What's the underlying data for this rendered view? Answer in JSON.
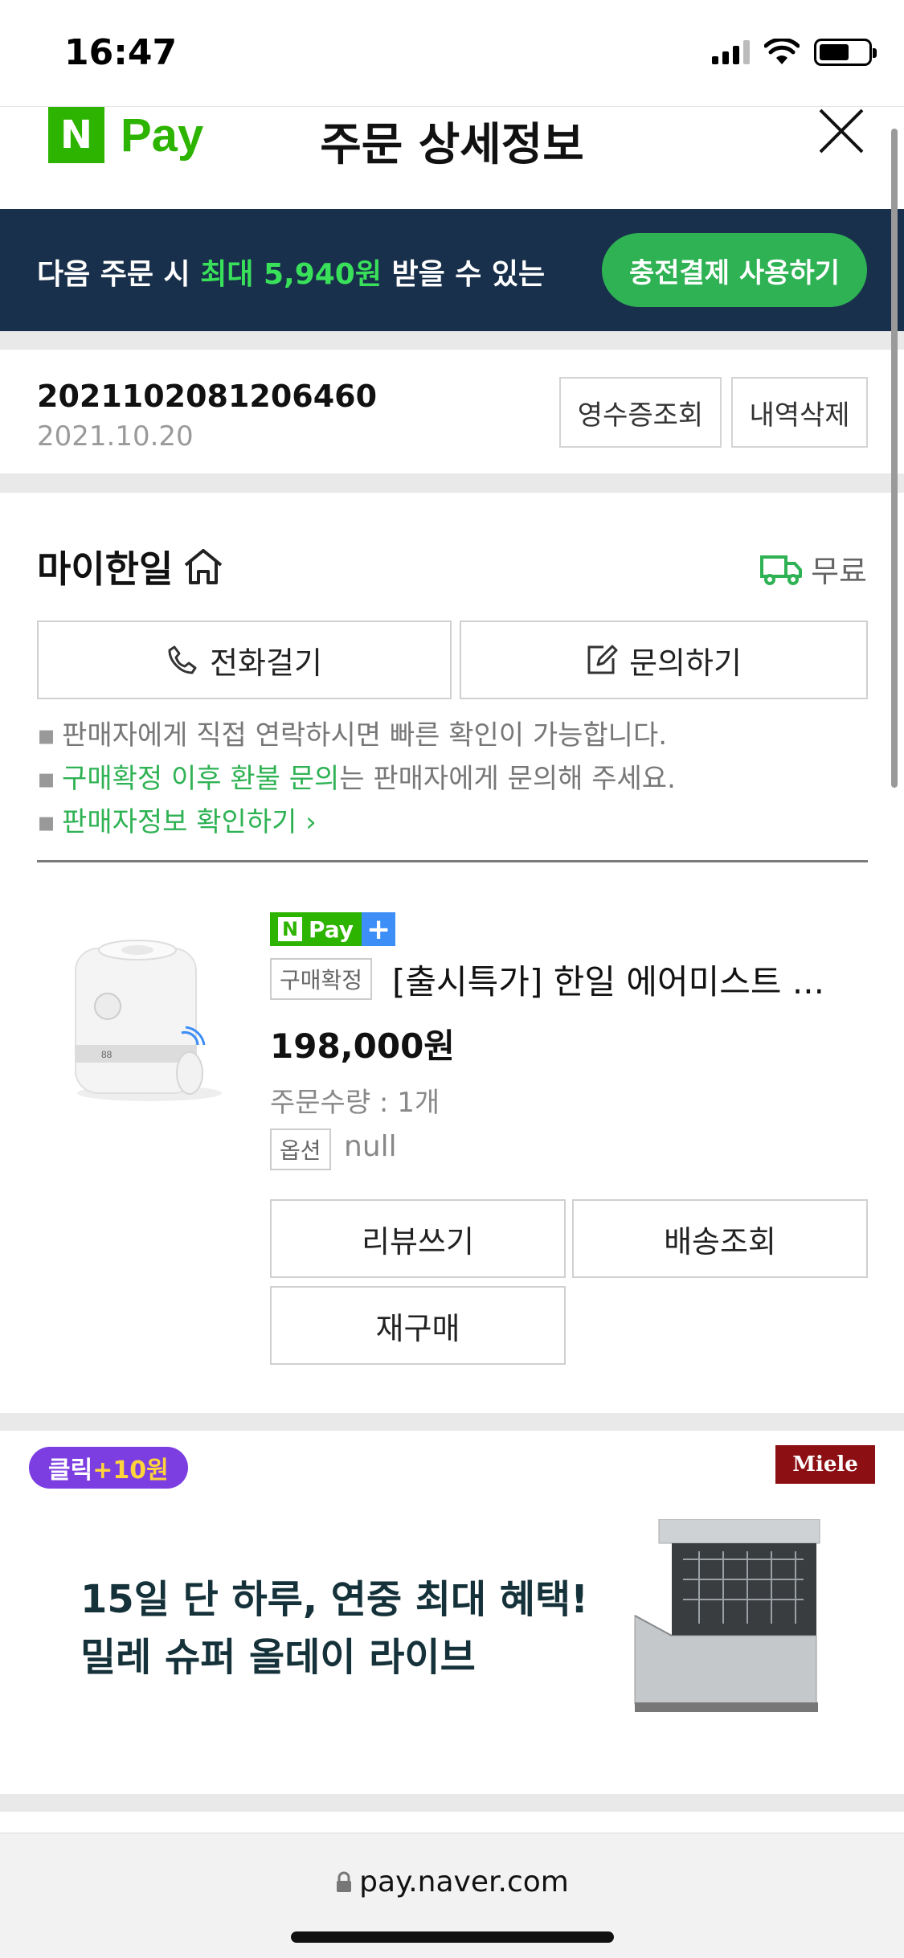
{
  "status_bar": {
    "time": "16:47"
  },
  "header": {
    "logo_n": "N",
    "logo_pay": "Pay",
    "title": "주문 상세정보"
  },
  "promo": {
    "text_before": "다음 주문 시 ",
    "text_highlight": "최대 5,940원",
    "text_after": " 받을 수 있는",
    "button": "충전결제 사용하기"
  },
  "order": {
    "number": "2021102081206460",
    "date": "2021.10.20",
    "receipt_button": "영수증조회",
    "delete_button": "내역삭제"
  },
  "seller": {
    "name": "마이한일",
    "shipping": "무료",
    "call_button": "전화걸기",
    "inquiry_button": "문의하기",
    "notes": {
      "line1": "판매자에게 직접 연락하시면 빠른 확인이 가능합니다.",
      "line2_green": "구매확정 이후 환불 문의",
      "line2_rest": "는 판매자에게 문의해 주세요.",
      "line3": "판매자정보 확인하기"
    }
  },
  "product": {
    "badge_n": "N",
    "badge_pay": "Pay",
    "badge_plus": "+",
    "status_tag": "구매확정",
    "title": "[출시특가] 한일 에어미스트 ...",
    "price": "198,000원",
    "quantity": "주문수량 : 1개",
    "option_tag": "옵션",
    "option_value": "null",
    "review_button": "리뷰쓰기",
    "tracking_button": "배송조회",
    "rebuy_button": "재구매"
  },
  "ad": {
    "badge_prefix": "클릭",
    "badge_reward": "+10원",
    "brand": "Miele",
    "line1": "15일 단 하루, 연중 최대 혜택!",
    "line2": "밀레 슈퍼 올데이 라이브"
  },
  "browser": {
    "url": "pay.naver.com"
  },
  "colors": {
    "brand_green": "#2db400",
    "promo_bg": "#18304b",
    "promo_button": "#2fb254",
    "ad_badge": "#7c3ee0",
    "miele_red": "#8c0f14"
  }
}
